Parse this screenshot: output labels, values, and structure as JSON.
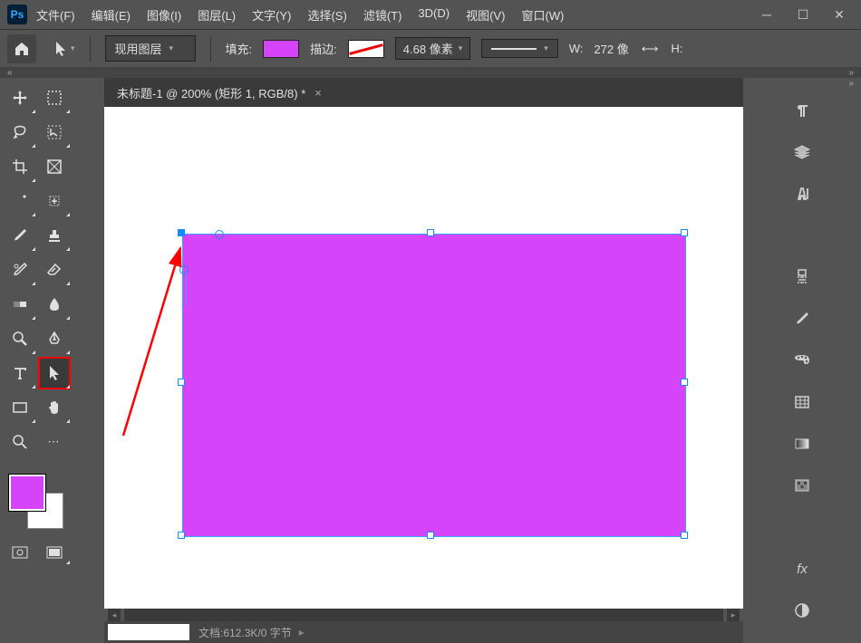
{
  "menu": {
    "items": [
      "文件(F)",
      "编辑(E)",
      "图像(I)",
      "图层(L)",
      "文字(Y)",
      "选择(S)",
      "滤镜(T)",
      "3D(D)",
      "视图(V)",
      "窗口(W)"
    ]
  },
  "options": {
    "layer_dropdown": "现用图层",
    "fill_label": "填充:",
    "stroke_label": "描边:",
    "stroke_value": "4.68 像素",
    "w_label": "W:",
    "w_value": "272 像",
    "link_label": "⟷",
    "h_label": "H:"
  },
  "tab": {
    "title": "未标题-1 @ 200% (矩形 1, RGB/8) *"
  },
  "status": {
    "text": "文档:612.3K/0 字节"
  },
  "colors": {
    "fill": "#d544f9",
    "stroke": "#ffffff"
  }
}
